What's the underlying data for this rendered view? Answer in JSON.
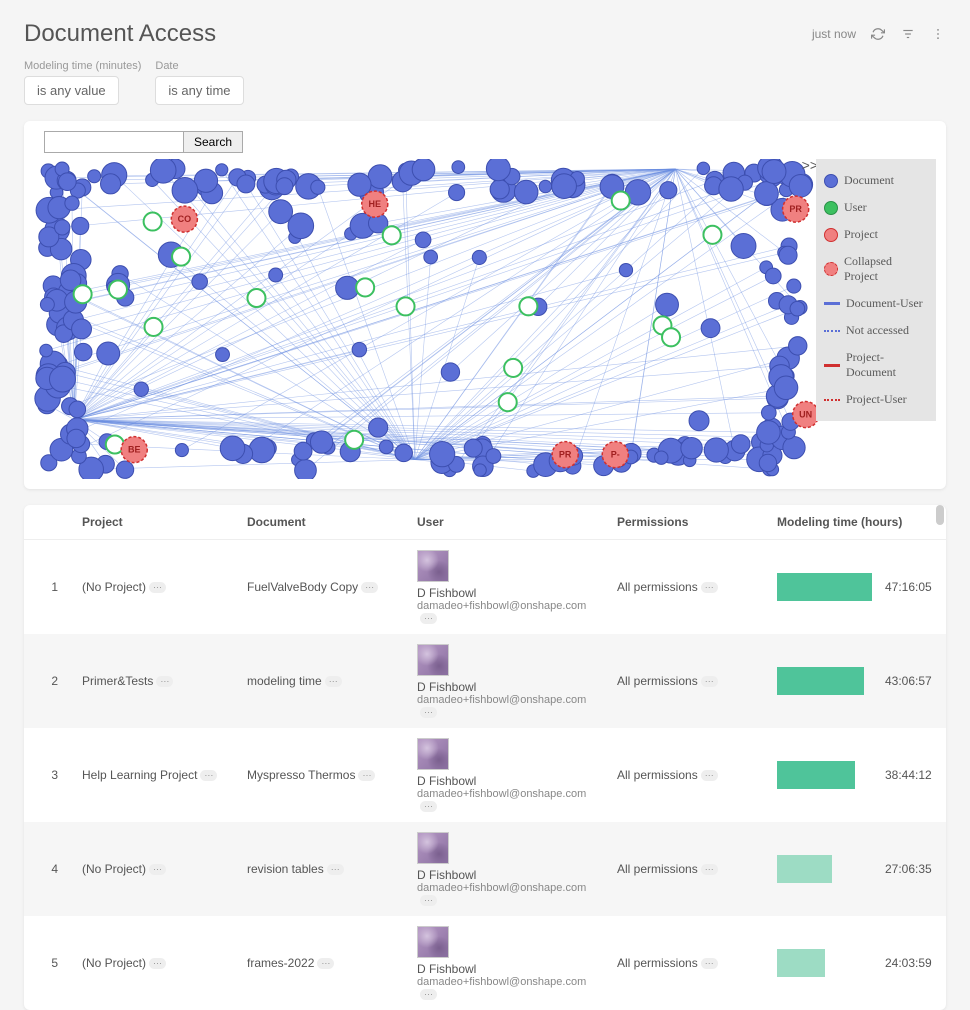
{
  "header": {
    "title": "Document Access",
    "timestamp": "just now"
  },
  "filters": {
    "modeling_time": {
      "label": "Modeling time (minutes)",
      "value": "is any value"
    },
    "date": {
      "label": "Date",
      "value": "is any time"
    }
  },
  "graph": {
    "search_button": "Search",
    "legend_toggle": ">>",
    "legend": [
      {
        "label": "Document",
        "type": "circle",
        "fill": "#5b6fd6",
        "stroke": "#3d4fb0"
      },
      {
        "label": "User",
        "type": "circle",
        "fill": "#3cc060",
        "stroke": "#2a9048"
      },
      {
        "label": "Project",
        "type": "circle",
        "fill": "#f08080",
        "stroke": "#d03030"
      },
      {
        "label": "Collapsed Project",
        "type": "circle",
        "fill": "#f08080",
        "stroke": "#d03030",
        "dashed": true
      },
      {
        "label": "Document-User",
        "type": "line",
        "color": "#5b6fd6"
      },
      {
        "label": "Not accessed",
        "type": "dashed",
        "color": "#5b6fd6"
      },
      {
        "label": "Project-Document",
        "type": "line",
        "color": "#d03030"
      },
      {
        "label": "Project-User",
        "type": "dashed",
        "color": "#d03030"
      }
    ],
    "project_labels": [
      "CO",
      "HE",
      "PR",
      "BE",
      "PR",
      "P-",
      "UN"
    ]
  },
  "table": {
    "columns": {
      "project": "Project",
      "document": "Document",
      "user": "User",
      "permissions": "Permissions",
      "modeling_time": "Modeling time (hours)"
    },
    "max_seconds": 180000,
    "rows": [
      {
        "idx": "1",
        "project": "(No Project)",
        "document": "FuelValveBody Copy",
        "user_name": "D Fishbowl",
        "user_email": "damadeo+fishbowl@onshape.com",
        "permissions": "All permissions",
        "time": "47:16:05",
        "pct": 95,
        "shade": "dark"
      },
      {
        "idx": "2",
        "project": "Primer&Tests",
        "document": "modeling time",
        "user_name": "D Fishbowl",
        "user_email": "damadeo+fishbowl@onshape.com",
        "permissions": "All permissions",
        "time": "43:06:57",
        "pct": 87,
        "shade": "dark"
      },
      {
        "idx": "3",
        "project": "Help Learning Project",
        "document": "Myspresso Thermos",
        "user_name": "D Fishbowl",
        "user_email": "damadeo+fishbowl@onshape.com",
        "permissions": "All permissions",
        "time": "38:44:12",
        "pct": 78,
        "shade": "dark"
      },
      {
        "idx": "4",
        "project": "(No Project)",
        "document": "revision tables",
        "user_name": "D Fishbowl",
        "user_email": "damadeo+fishbowl@onshape.com",
        "permissions": "All permissions",
        "time": "27:06:35",
        "pct": 55,
        "shade": "light"
      },
      {
        "idx": "5",
        "project": "(No Project)",
        "document": "frames-2022",
        "user_name": "D Fishbowl",
        "user_email": "damadeo+fishbowl@onshape.com",
        "permissions": "All permissions",
        "time": "24:03:59",
        "pct": 48,
        "shade": "light"
      }
    ]
  }
}
